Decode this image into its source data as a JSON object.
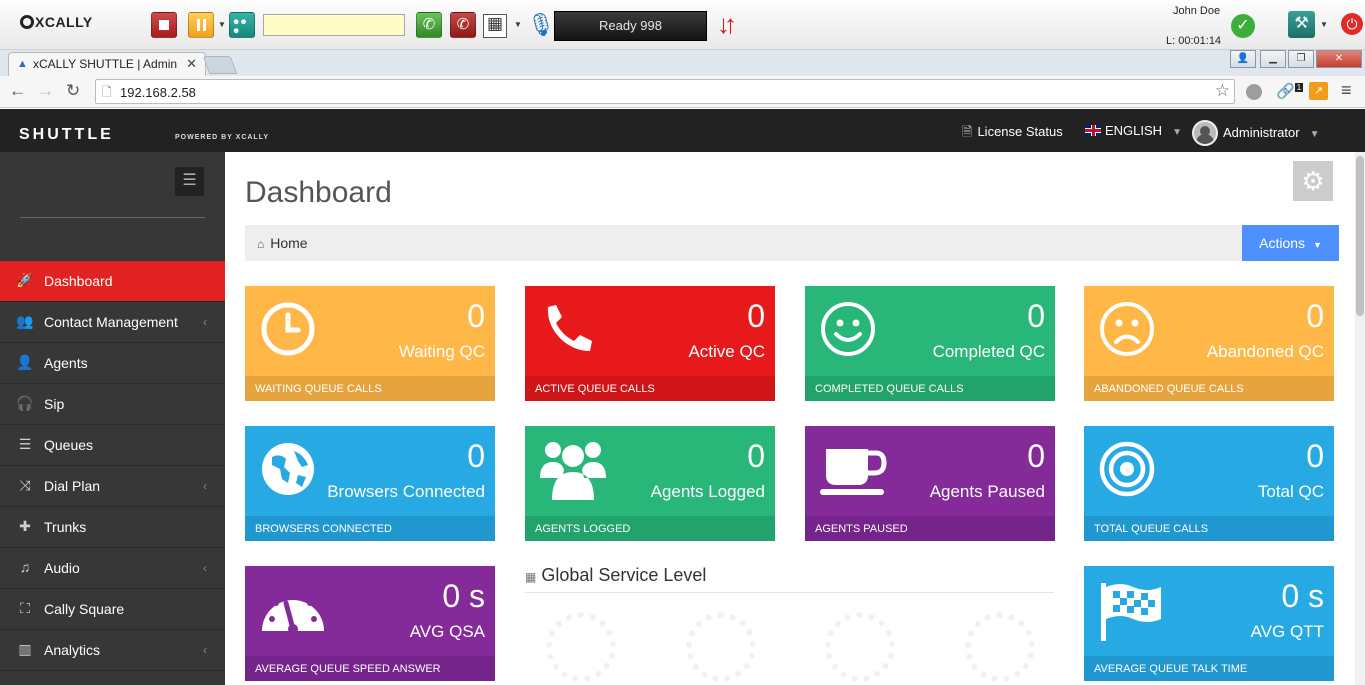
{
  "phonebar": {
    "logo": "XCALLY",
    "dial_value": "",
    "status": "Ready 998",
    "agent_name": "John Doe",
    "timer": "L: 00:01:14"
  },
  "browser": {
    "tab_title": "xCALLY SHUTTLE | Admin",
    "url": "192.168.2.58",
    "ext_badge": "1"
  },
  "header": {
    "brand": "SHUTTLE",
    "powered": "POWERED BY XCALLY",
    "license": "License Status",
    "language": "ENGLISH",
    "user": "Administrator"
  },
  "sidebar": {
    "items": [
      {
        "label": "Dashboard",
        "icon": "rocket-icon",
        "active": true
      },
      {
        "label": "Contact Management",
        "icon": "group-icon",
        "submenu": true
      },
      {
        "label": "Agents",
        "icon": "user-icon"
      },
      {
        "label": "Sip",
        "icon": "headphones-icon"
      },
      {
        "label": "Queues",
        "icon": "list-icon"
      },
      {
        "label": "Dial Plan",
        "icon": "shuffle-icon",
        "submenu": true
      },
      {
        "label": "Trunks",
        "icon": "puzzle-icon"
      },
      {
        "label": "Audio",
        "icon": "music-icon",
        "submenu": true
      },
      {
        "label": "Cally Square",
        "icon": "sitemap-icon"
      },
      {
        "label": "Analytics",
        "icon": "bar-chart-icon",
        "submenu": true
      }
    ]
  },
  "page": {
    "title": "Dashboard",
    "breadcrumb": "Home",
    "actions": "Actions"
  },
  "tiles": [
    {
      "value": "0",
      "label": "Waiting QC",
      "footer": "WAITING QUEUE CALLS",
      "color": "#ffb848",
      "icon": "clock-icon"
    },
    {
      "value": "0",
      "label": "Active QC",
      "footer": "ACTIVE QUEUE CALLS",
      "color": "#e7191b",
      "icon": "phone-icon"
    },
    {
      "value": "0",
      "label": "Completed QC",
      "footer": "COMPLETED QUEUE CALLS",
      "color": "#28b779",
      "icon": "smile-icon"
    },
    {
      "value": "0",
      "label": "Abandoned QC",
      "footer": "ABANDONED QUEUE CALLS",
      "color": "#ffb848",
      "icon": "frown-icon"
    },
    {
      "value": "0",
      "label": "Browsers Connected",
      "footer": "BROWSERS CONNECTED",
      "color": "#27a9e3",
      "icon": "globe-icon"
    },
    {
      "value": "0",
      "label": "Agents Logged",
      "footer": "AGENTS LOGGED",
      "color": "#28b779",
      "icon": "group-icon"
    },
    {
      "value": "0",
      "label": "Agents Paused",
      "footer": "AGENTS PAUSED",
      "color": "#852b99",
      "icon": "coffee-icon"
    },
    {
      "value": "0",
      "label": "Total QC",
      "footer": "TOTAL QUEUE CALLS",
      "color": "#27a9e3",
      "icon": "bullseye-icon"
    },
    {
      "value": "0 s",
      "label": "AVG QSA",
      "footer": "AVERAGE QUEUE SPEED ANSWER",
      "color": "#852b99",
      "icon": "dashboard-icon"
    },
    {
      "value": "0 s",
      "label": "AVG QTT",
      "footer": "AVERAGE QUEUE TALK TIME",
      "color": "#27a9e3",
      "icon": "flag-icon"
    }
  ],
  "service_level": {
    "title": "Global Service Level"
  }
}
